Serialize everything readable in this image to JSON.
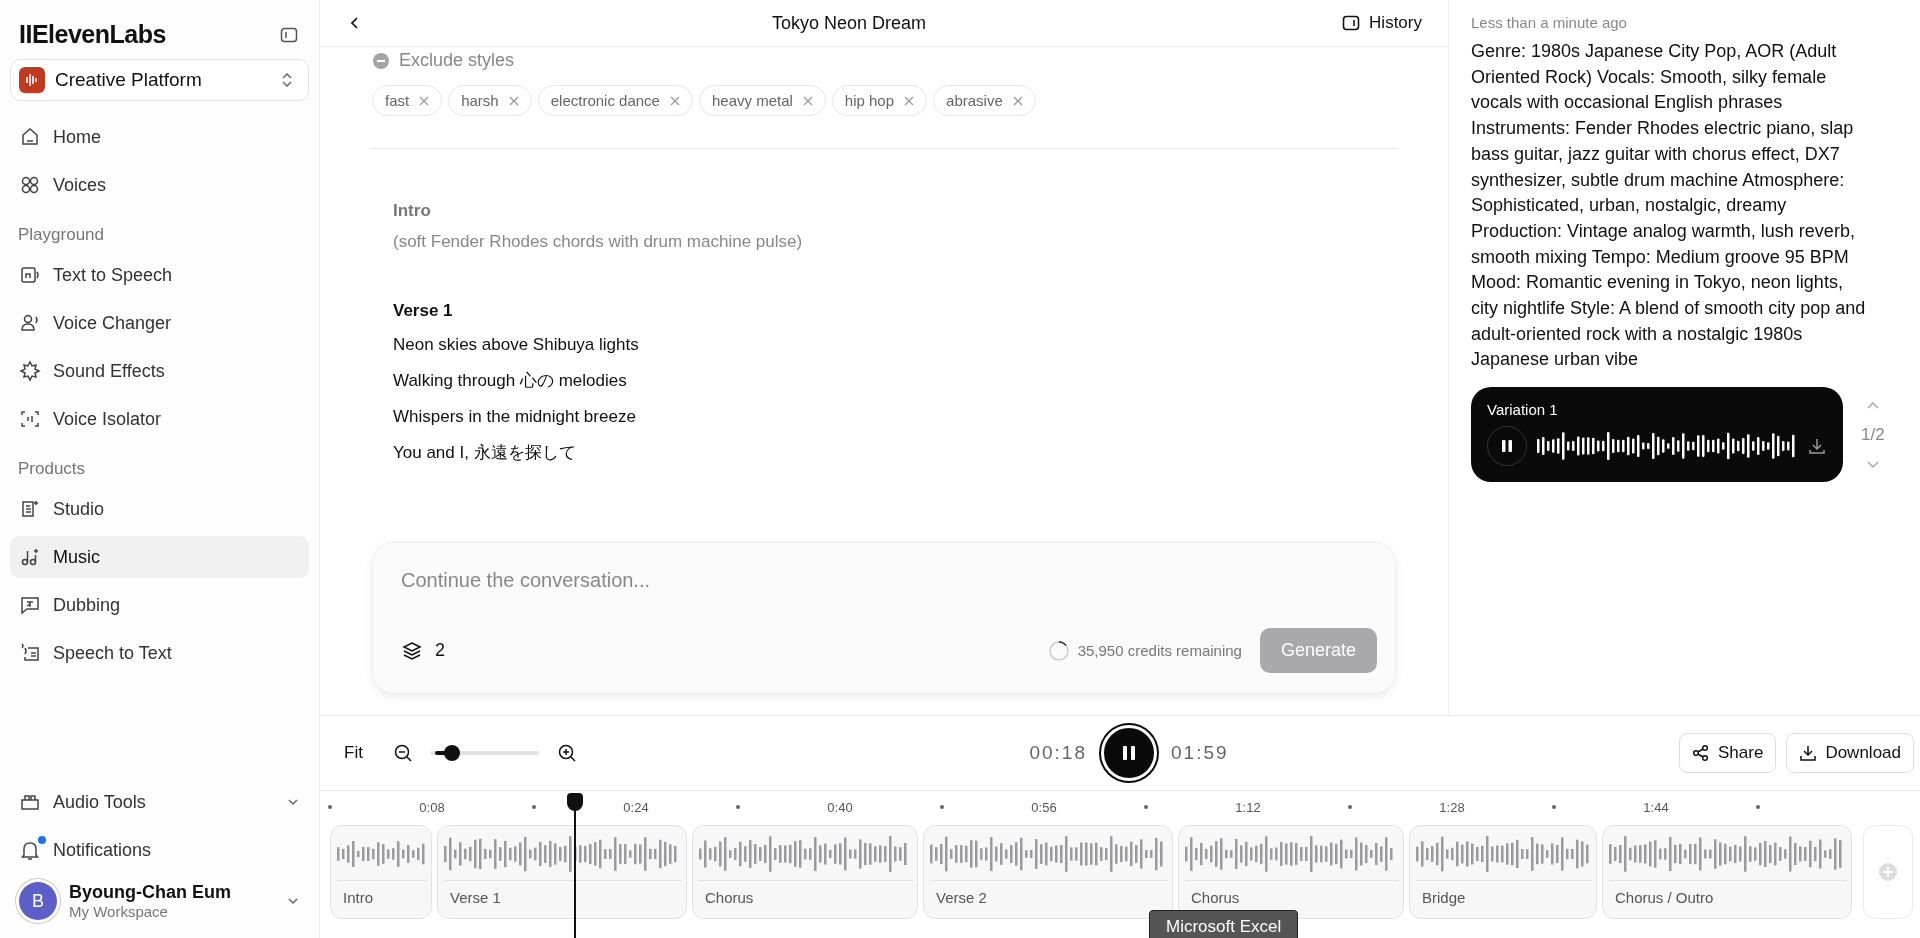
{
  "sidebar": {
    "logo": "IIElevenLabs",
    "workspace": "Creative Platform",
    "top_items": [
      {
        "label": "Home",
        "selected": false
      },
      {
        "label": "Voices",
        "selected": false
      }
    ],
    "sections": [
      {
        "title": "Playground",
        "items": [
          {
            "label": "Text to Speech",
            "selected": false
          },
          {
            "label": "Voice Changer",
            "selected": false
          },
          {
            "label": "Sound Effects",
            "selected": false
          },
          {
            "label": "Voice Isolator",
            "selected": false
          }
        ]
      },
      {
        "title": "Products",
        "items": [
          {
            "label": "Studio",
            "selected": false
          },
          {
            "label": "Music",
            "selected": true
          },
          {
            "label": "Dubbing",
            "selected": false
          },
          {
            "label": "Speech to Text",
            "selected": false
          }
        ]
      }
    ],
    "bottom_items": [
      {
        "label": "Audio Tools",
        "kind": "dropdown"
      },
      {
        "label": "Notifications",
        "kind": "notifications",
        "unread": true
      }
    ],
    "user": {
      "initial": "B",
      "name": "Byoung-Chan Eum",
      "workspace": "My Workspace"
    }
  },
  "header": {
    "title": "Tokyo Neon Dream",
    "history": "History"
  },
  "exclude": {
    "label": "Exclude styles",
    "tags": [
      "fast",
      "harsh",
      "electronic dance",
      "heavy metal",
      "hip hop",
      "abrasive"
    ]
  },
  "lyrics": [
    {
      "kind": "direction",
      "heading": "Intro",
      "lines": [
        "(soft Fender Rhodes chords with drum machine pulse)"
      ]
    },
    {
      "kind": "verse",
      "heading": "Verse 1",
      "lines": [
        "Neon skies above Shibuya lights",
        "Walking through 心の melodies",
        "Whispers in the midnight breeze",
        "You and I, 永遠を探して"
      ]
    }
  ],
  "composer": {
    "placeholder": "Continue the conversation...",
    "count": "2",
    "credits": "35,950 credits remaining",
    "generate": "Generate",
    "disabled": true
  },
  "history": {
    "time": "Less than a minute ago",
    "prompt": "Genre: 1980s Japanese City Pop, AOR (Adult Oriented Rock) Vocals: Smooth, silky female vocals with occasional English phrases Instruments: Fender Rhodes electric piano, slap bass guitar, jazz guitar with chorus effect, DX7 synthesizer, subtle drum machine Atmosphere: Sophisticated, urban, nostalgic, dreamy Production: Vintage analog warmth, lush reverb, smooth mixing Tempo: Medium groove 95 BPM Mood: Romantic evening in Tokyo, neon lights, city nightlife Style: A blend of smooth city pop and adult-oriented rock with a nostalgic 1980s Japanese urban vibe",
    "variation": "Variation 1",
    "playing": true,
    "pager": "1/2"
  },
  "player": {
    "fit": "Fit",
    "zoom": {
      "level": 0.2
    },
    "current": "00:18",
    "total": "01:59",
    "playing": true,
    "share": "Share",
    "download": "Download"
  },
  "timeline": {
    "ticks": [
      "0:08",
      "0:24",
      "0:40",
      "0:56",
      "1:12",
      "1:28",
      "1:44"
    ],
    "segments": [
      {
        "label": "Intro"
      },
      {
        "label": "Verse 1"
      },
      {
        "label": "Chorus"
      },
      {
        "label": "Verse 2"
      },
      {
        "label": "Chorus"
      },
      {
        "label": "Bridge"
      },
      {
        "label": "Chorus / Outro"
      }
    ]
  },
  "tooltip": "Microsoft Excel"
}
